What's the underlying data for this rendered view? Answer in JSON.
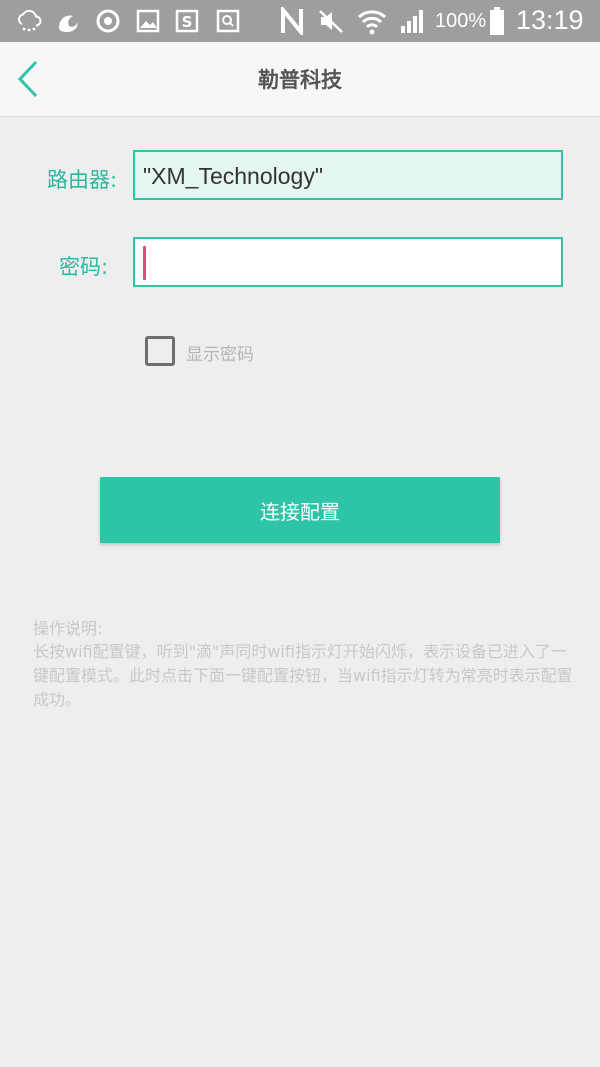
{
  "status_bar": {
    "battery_percent": "100%",
    "time": "13:19",
    "icons": [
      "weather-icon",
      "uc-browser-icon",
      "sync-icon",
      "gallery-icon",
      "s-app-icon",
      "search-app-icon",
      "nfc-icon",
      "mute-icon",
      "wifi-icon",
      "signal-icon",
      "battery-icon"
    ]
  },
  "header": {
    "title": "勒普科技",
    "accent_color": "#2ec4a7"
  },
  "form": {
    "router_label": "路由器:",
    "router_value": "\"XM_Technology\"",
    "password_label": "密码:",
    "password_value": "",
    "show_password_label": "显示密码",
    "show_password_checked": false,
    "connect_button": "连接配置"
  },
  "help": {
    "title": "操作说明:",
    "text": "长按wifi配置键，听到\"滴\"声同时wifi指示灯开始闪烁，表示设备已进入了一键配置模式。此时点击下面一键配置按钮，当wifi指示灯转为常亮时表示配置成功。"
  }
}
